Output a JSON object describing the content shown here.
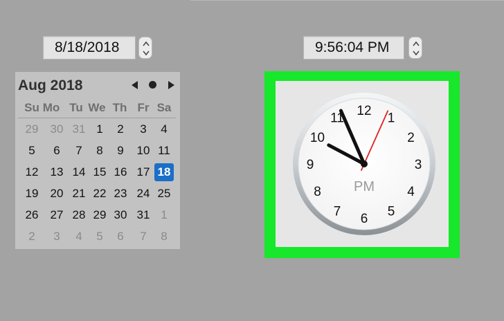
{
  "date_picker": {
    "value": "8/18/2018",
    "calendar": {
      "month_label": "Aug 2018",
      "weekdays": [
        "Su",
        "Mo",
        "Tu",
        "We",
        "Th",
        "Fr",
        "Sa"
      ],
      "weeks": [
        [
          "29",
          "30",
          "31",
          "1",
          "2",
          "3",
          "4"
        ],
        [
          "5",
          "6",
          "7",
          "8",
          "9",
          "10",
          "11"
        ],
        [
          "12",
          "13",
          "14",
          "15",
          "16",
          "17",
          "18"
        ],
        [
          "19",
          "20",
          "21",
          "22",
          "23",
          "24",
          "25"
        ],
        [
          "26",
          "27",
          "28",
          "29",
          "30",
          "31",
          "1"
        ],
        [
          "2",
          "3",
          "4",
          "5",
          "6",
          "7",
          "8"
        ]
      ],
      "selected_day": "18"
    }
  },
  "time_picker": {
    "value": "9:56:04 PM"
  },
  "clock": {
    "numbers": [
      "12",
      "1",
      "2",
      "3",
      "4",
      "5",
      "6",
      "7",
      "8",
      "9",
      "10",
      "11"
    ],
    "period": "PM",
    "time": {
      "hours": 9,
      "minutes": 56,
      "seconds": 4
    }
  },
  "colors": {
    "highlight_border": "#17e82b",
    "selected_day": "#1a6fc7",
    "second_hand": "#e02020"
  },
  "icons": {
    "stepper": "stepper-arrows-icon",
    "prev": "triangle-left-icon",
    "today": "dot-icon",
    "next": "triangle-right-icon"
  }
}
